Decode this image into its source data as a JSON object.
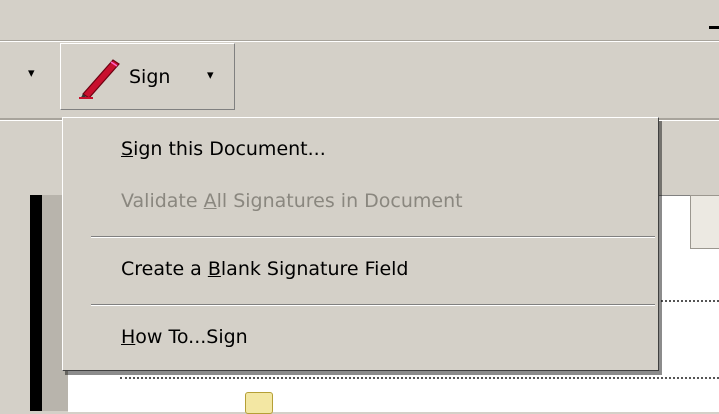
{
  "toolbar": {
    "sign_button": {
      "label": "Sign",
      "dropdown_caret": "▾"
    },
    "left_dropdown_caret": "▾"
  },
  "menu": {
    "items": [
      {
        "prefix": "",
        "mnemonic": "S",
        "suffix": "ign this Document...",
        "enabled": true
      },
      {
        "prefix": "Validate ",
        "mnemonic": "A",
        "suffix": "ll Signatures in Document",
        "enabled": false
      },
      {
        "prefix": "Create a ",
        "mnemonic": "B",
        "suffix": "lank Signature Field",
        "enabled": true
      },
      {
        "prefix": "",
        "mnemonic": "H",
        "suffix": "ow To...Sign",
        "enabled": true
      }
    ]
  },
  "icons": {
    "pen": "pen-icon",
    "minimize": "minimize-icon",
    "note": "note-icon"
  },
  "colors": {
    "chrome": "#d4d0c8",
    "disabled_text": "#8a877f",
    "pen_red": "#c8102e"
  }
}
